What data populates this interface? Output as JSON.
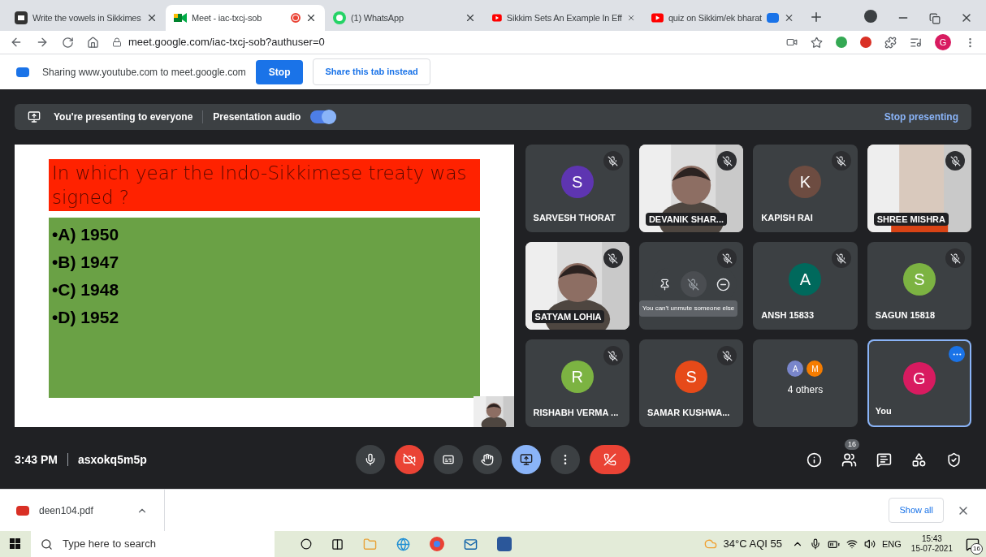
{
  "tabs": [
    {
      "kind": "doc",
      "title": "Write the vowels in Sikkimes",
      "selected": false,
      "recording": false,
      "sharing": false
    },
    {
      "kind": "meet",
      "title": "Meet - iac-txcj-sob",
      "selected": true,
      "recording": true,
      "sharing": false
    },
    {
      "kind": "whatsapp",
      "title": "(1) WhatsApp",
      "selected": false,
      "recording": false,
      "sharing": false
    },
    {
      "kind": "youtube",
      "title": "Sikkim Sets An Example In Eff",
      "selected": false,
      "recording": false,
      "sharing": false
    },
    {
      "kind": "youtube",
      "title": "quiz on Sikkim/ek bharat",
      "selected": false,
      "recording": false,
      "sharing": true
    }
  ],
  "address": "meet.google.com/iac-txcj-sob?authuser=0",
  "profile_initial": "G",
  "sharing_bar": {
    "text": "Sharing www.youtube.com to meet.google.com",
    "stop": "Stop",
    "share_tab": "Share this tab instead"
  },
  "presenting_banner": {
    "text": "You're presenting to everyone",
    "audio_label": "Presentation audio",
    "audio_on": true,
    "stop": "Stop presenting"
  },
  "slide": {
    "question": "In which year the Indo-Sikkimese treaty was signed ?",
    "options": [
      "•A) 1950",
      "•B) 1947",
      "•C) 1948",
      "•D) 1952"
    ]
  },
  "tiles": [
    {
      "kind": "avatar",
      "name": "SARVESH THORAT",
      "initial": "S",
      "color": "#5e35b1",
      "muted": true
    },
    {
      "kind": "video",
      "name": "DEVANIK SHAR...",
      "muted": true
    },
    {
      "kind": "avatar",
      "name": "KAPISH RAI",
      "initial": "K",
      "color": "#6d4c41",
      "muted": true
    },
    {
      "kind": "video",
      "name": "SHREE MISHRA",
      "muted": true
    },
    {
      "kind": "video",
      "name": "SATYAM LOHIA",
      "muted": true
    },
    {
      "kind": "hover",
      "muted": true,
      "tooltip": "You can't unmute someone else"
    },
    {
      "kind": "avatar",
      "name": "ANSH 15833",
      "initial": "A",
      "color": "#00695c",
      "muted": true
    },
    {
      "kind": "avatar",
      "name": "SAGUN 15818",
      "initial": "S",
      "color": "#7cb342",
      "muted": true
    },
    {
      "kind": "avatar",
      "name": "RISHABH VERMA ...",
      "initial": "R",
      "color": "#7cb342",
      "muted": true
    },
    {
      "kind": "avatar",
      "name": "SAMAR KUSHWA...",
      "initial": "S",
      "color": "#e64a19",
      "muted": true
    },
    {
      "kind": "others",
      "name": "4 others",
      "avatars": [
        {
          "initial": "A",
          "color": "#7986cb"
        },
        {
          "initial": "M",
          "color": "#f57c00"
        }
      ]
    },
    {
      "kind": "self",
      "name": "You",
      "initial": "G",
      "color": "#d81b60",
      "selected": true
    }
  ],
  "meeting": {
    "time": "3:43 PM",
    "code": "asxokq5m5p"
  },
  "controls": [
    {
      "kind": "mic",
      "color": "#3c4043"
    },
    {
      "kind": "camera",
      "color": "#ea4335"
    },
    {
      "kind": "captions",
      "color": "#3c4043"
    },
    {
      "kind": "hand",
      "color": "#3c4043"
    },
    {
      "kind": "present",
      "color": "#8ab4f8"
    },
    {
      "kind": "more",
      "color": "#3c4043"
    },
    {
      "kind": "leave",
      "color": "#ea4335"
    }
  ],
  "side_icons": [
    {
      "kind": "info"
    },
    {
      "kind": "people",
      "badge": "16"
    },
    {
      "kind": "chat"
    },
    {
      "kind": "activities"
    },
    {
      "kind": "host"
    }
  ],
  "downloads": {
    "file": "deen104.pdf",
    "show_all": "Show all"
  },
  "taskbar": {
    "search_placeholder": "Type here to search",
    "weather": "34°C AQI 55",
    "language": "ENG",
    "time": "15:43",
    "date": "15-07-2021",
    "notifications": "16"
  }
}
